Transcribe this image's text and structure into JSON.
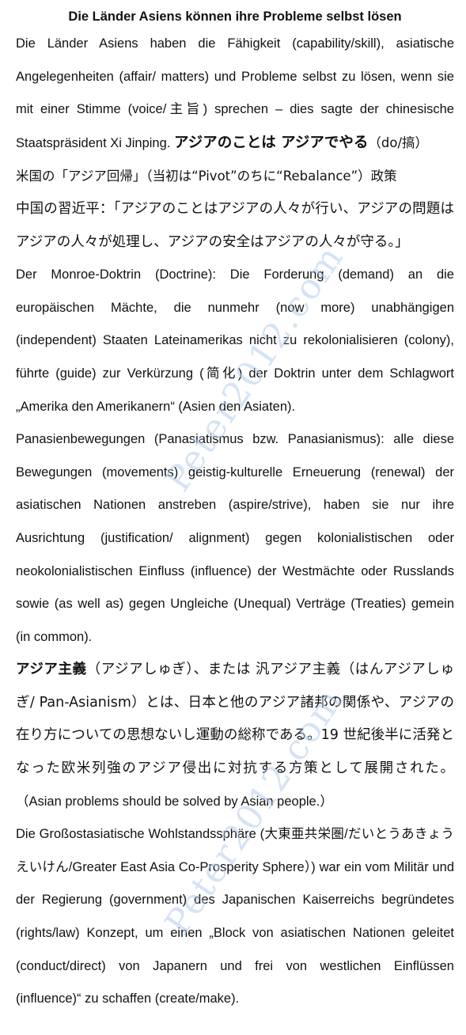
{
  "title": "Die Länder Asiens können ihre Probleme selbst lösen",
  "watermark": "Peter2012.com",
  "p1": {
    "text": "Die Länder Asiens haben die Fähigkeit (capability/skill), asiatische Angelegenheiten (affair/ matters) und Probleme selbst zu lösen, wenn sie mit einer Stimme (voice/主旨) sprechen – dies sagte der chinesische Staatspräsident Xi Jinping. ",
    "jp_big": "アジアのことは アジアでやる",
    "jp_tail": "（do/搞）"
  },
  "p2": "米国の「アジア回帰」（当初は“Pivot”のちに“Rebalance”）政策",
  "p3": "中国の習近平：「アジアのことはアジアの人々が行い、アジアの問題はアジアの人々が処理し、アジアの安全はアジアの人々が守る。」",
  "p4": "Der Monroe-Doktrin (Doctrine): Die Forderung (demand) an die europäischen Mächte, die nunmehr (now more) unabhängigen (independent) Staaten Lateinamerikas nicht zu rekolonialisieren (colony), führte (guide) zur Verkürzung (简化) der Doktrin unter dem Schlagwort „Amerika den Amerikanern“ (Asien den Asiaten).",
  "p5": "Panasienbewegungen (Panasiatismus bzw. Panasianismus): alle diese Bewegungen (movements) geistig-kulturelle Erneuerung (renewal) der asiatischen Nationen anstreben (aspire/strive), haben sie nur ihre Ausrichtung (justification/ alignment) gegen kolonialistischen oder neokolonialistischen Einfluss (influence) der Westmächte oder Russlands sowie (as well as) gegen Ungleiche (Unequal) Verträge (Treaties) gemein (in common).",
  "p6": {
    "bold": "アジア主義",
    "text": "（アジアしゅぎ）、または 汎アジア主義（はんアジアしゅぎ/ Pan-Asianism）とは、日本と他のアジア諸邦の関係や、アジアの在り方についての思想ないし運動の総称である。19 世紀後半に活発となった欧米列強のアジア侵出に対抗する方策として展開された。",
    "en": "（Asian problems should be solved by Asian people.）"
  },
  "p7": "Die Großostasiatische Wohlstandssphäre (大東亜共栄圏/だいとうあきょうえいけん/Greater East Asia Co-Prosperity Sphere）) war ein vom Militär und der Regierung (government) des Japanischen Kaiserreichs begründetes (rights/law) Konzept, um einen „Block von asiatischen Nationen geleitet (conduct/direct) von Japanern und frei von westlichen Einflüssen (influence)“ zu schaffen (create/make)."
}
